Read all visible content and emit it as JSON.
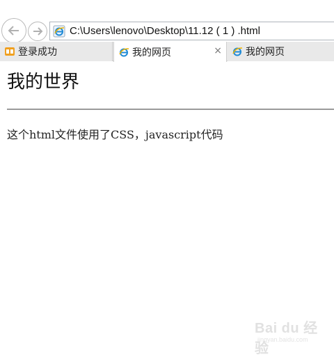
{
  "browser": {
    "address": "C:\\Users\\lenovo\\Desktop\\11.12 ( 1 ) .html",
    "tabs": [
      {
        "label": "登录成功",
        "icon": "app-icon",
        "active": false
      },
      {
        "label": "我的网页",
        "icon": "ie-icon",
        "active": true,
        "close": "×"
      },
      {
        "label": "我的网页",
        "icon": "ie-icon",
        "active": false
      }
    ]
  },
  "page": {
    "title": "我的世界",
    "text": "这个html文件使用了CSS，javascript代码"
  },
  "watermark": {
    "main": "Bai du 经验",
    "sub": "jingyan.baidu.com"
  }
}
